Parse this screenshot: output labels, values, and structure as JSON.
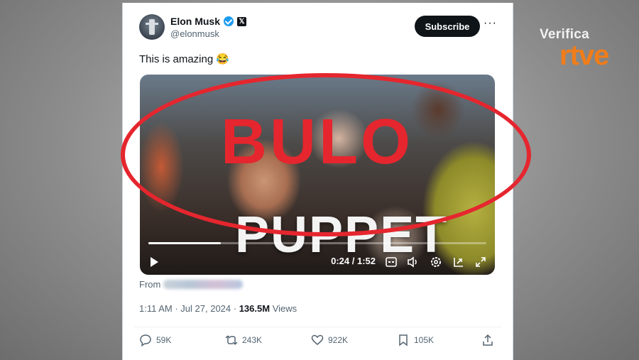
{
  "brand": {
    "top": "Verifica",
    "bottom": "rtve",
    "accent_color": "#f07d1a"
  },
  "author": {
    "name": "Elon Musk",
    "handle": "@elonmusk",
    "verified_icon": "verified-badge-icon",
    "affiliate_icon": "x-logo-icon"
  },
  "header": {
    "subscribe_label": "Subscribe",
    "more_label": "···"
  },
  "tweet": {
    "text": "This is amazing 😂"
  },
  "video": {
    "overlay_text": "PUPPET",
    "current_time": "0:24",
    "separator": " / ",
    "duration": "1:52",
    "progress": 0.214,
    "icons": [
      "play-icon",
      "captions-icon",
      "volume-icon",
      "settings-icon",
      "pip-icon",
      "fullscreen-icon"
    ]
  },
  "stamp": {
    "text": "BULO",
    "color": "#e5262e"
  },
  "source": {
    "from_label": "From"
  },
  "meta": {
    "time": "1:11 AM",
    "dot": " · ",
    "date": "Jul 27, 2024",
    "dot2": " · ",
    "views_count": "136.5M",
    "views_label": " Views"
  },
  "actions": {
    "replies": "59K",
    "reposts": "243K",
    "likes": "922K",
    "bookmarks": "105K"
  }
}
